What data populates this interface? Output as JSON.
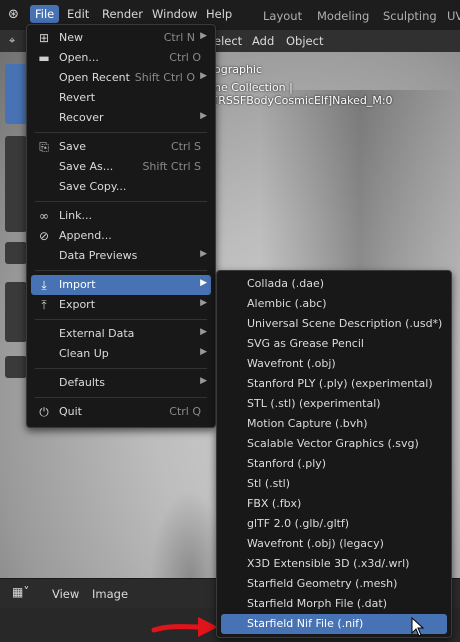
{
  "topbar": {
    "menus": [
      "File",
      "Edit",
      "Render",
      "Window",
      "Help"
    ],
    "workspaces": [
      "Layout",
      "Modeling",
      "Sculpting",
      "UV"
    ]
  },
  "viewport": {
    "header_menus": [
      "elect",
      "Add",
      "Object"
    ],
    "overlay_line1": "ographic",
    "overlay_line2": "ne Collection | [RSSFBodyCosmicElf]Naked_M:0"
  },
  "bottom": {
    "menus": [
      "View",
      "Image"
    ]
  },
  "file_menu": {
    "new": {
      "label": "New",
      "shortcut": "Ctrl N"
    },
    "open": {
      "label": "Open...",
      "shortcut": "Ctrl O"
    },
    "open_recent": {
      "label": "Open Recent",
      "shortcut": "Shift Ctrl O"
    },
    "revert": {
      "label": "Revert"
    },
    "recover": {
      "label": "Recover"
    },
    "save": {
      "label": "Save",
      "shortcut": "Ctrl S"
    },
    "save_as": {
      "label": "Save As...",
      "shortcut": "Shift Ctrl S"
    },
    "save_copy": {
      "label": "Save Copy..."
    },
    "link": {
      "label": "Link..."
    },
    "append": {
      "label": "Append..."
    },
    "data_previews": {
      "label": "Data Previews"
    },
    "import": {
      "label": "Import"
    },
    "export": {
      "label": "Export"
    },
    "external_data": {
      "label": "External Data"
    },
    "clean_up": {
      "label": "Clean Up"
    },
    "defaults": {
      "label": "Defaults"
    },
    "quit": {
      "label": "Quit",
      "shortcut": "Ctrl Q"
    }
  },
  "import_menu": {
    "items": [
      "Collada (.dae)",
      "Alembic (.abc)",
      "Universal Scene Description (.usd*)",
      "SVG as Grease Pencil",
      "Wavefront (.obj)",
      "Stanford PLY (.ply) (experimental)",
      "STL (.stl) (experimental)",
      "Motion Capture (.bvh)",
      "Scalable Vector Graphics (.svg)",
      "Stanford (.ply)",
      "Stl (.stl)",
      "FBX (.fbx)",
      "glTF 2.0 (.glb/.gltf)",
      "Wavefront (.obj) (legacy)",
      "X3D Extensible 3D (.x3d/.wrl)",
      "Starfield Geometry (.mesh)",
      "Starfield Morph File (.dat)",
      "Starfield Nif File (.nif)"
    ]
  },
  "colors": {
    "accent": "#4772b3",
    "annotation_arrow": "#e0141a"
  }
}
